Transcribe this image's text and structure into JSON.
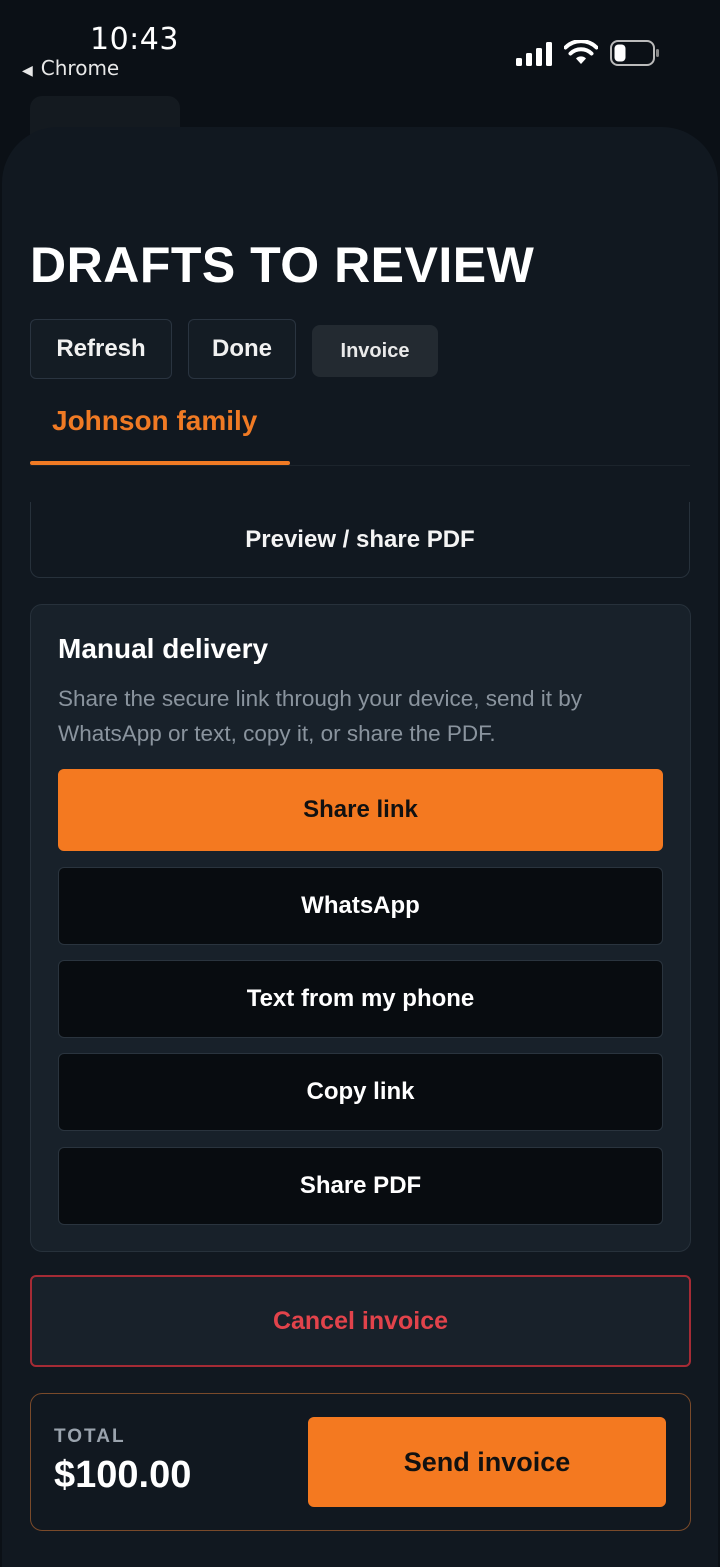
{
  "status_bar": {
    "time": "10:43",
    "back_app": "Chrome",
    "back_arrow": "◀"
  },
  "header": {
    "title": "DRAFTS TO REVIEW",
    "refresh_label": "Refresh",
    "done_label": "Done",
    "chip_label": "Invoice"
  },
  "tabs": {
    "active_label": "Johnson family"
  },
  "preview": {
    "label": "Preview / share PDF"
  },
  "manual_delivery": {
    "title": "Manual delivery",
    "description": "Share the secure link through your device, send it by WhatsApp or text, copy it, or share the PDF.",
    "actions": [
      {
        "label": "Share link"
      },
      {
        "label": "WhatsApp"
      },
      {
        "label": "Text from my phone"
      },
      {
        "label": "Copy link"
      },
      {
        "label": "Share PDF"
      }
    ]
  },
  "cancel": {
    "label": "Cancel invoice"
  },
  "footer": {
    "total_label": "TOTAL",
    "total_value": "$100.00",
    "send_label": "Send invoice"
  },
  "colors": {
    "accent": "#f47920",
    "danger": "#e2434b",
    "background": "#0b1016",
    "card": "#18212a"
  },
  "icons": [
    "signal-icon",
    "wifi-icon",
    "battery-icon",
    "back-arrow-icon"
  ]
}
